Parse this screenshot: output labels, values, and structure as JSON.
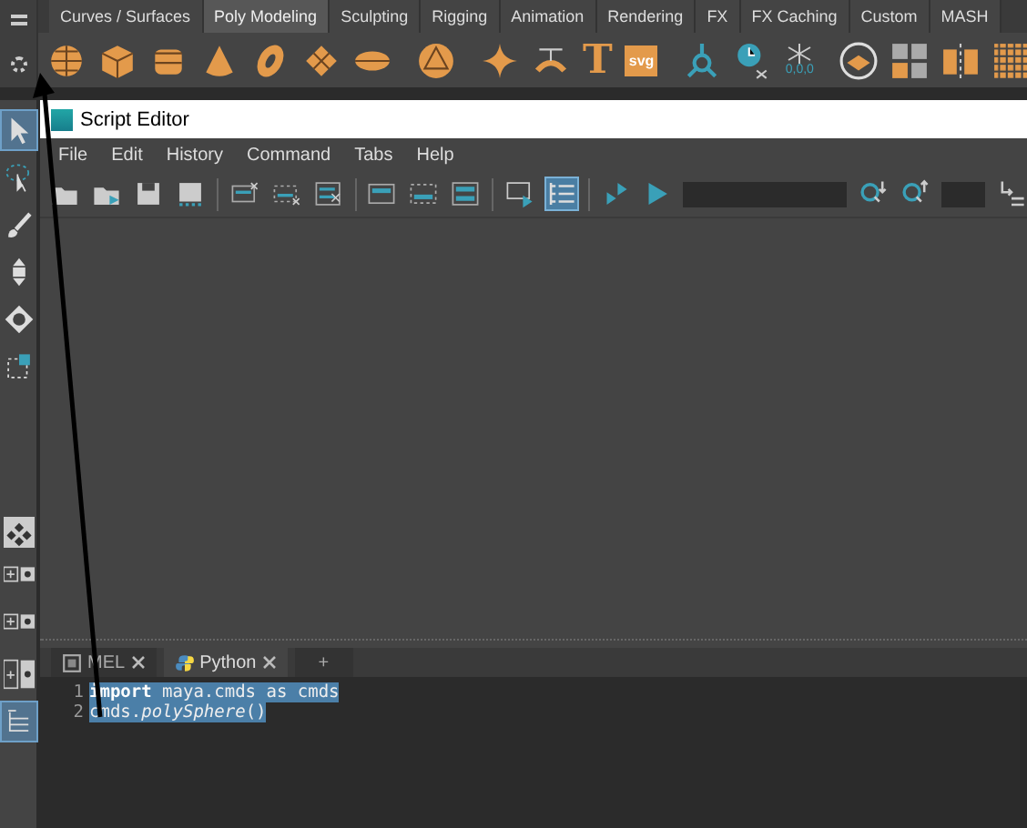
{
  "shelf": {
    "tabs": [
      {
        "label": "Curves / Surfaces",
        "selected": false
      },
      {
        "label": "Poly Modeling",
        "selected": true
      },
      {
        "label": "Sculpting",
        "selected": false
      },
      {
        "label": "Rigging",
        "selected": false
      },
      {
        "label": "Animation",
        "selected": false
      },
      {
        "label": "Rendering",
        "selected": false
      },
      {
        "label": "FX",
        "selected": false
      },
      {
        "label": "FX Caching",
        "selected": false
      },
      {
        "label": "Custom",
        "selected": false
      },
      {
        "label": "MASH",
        "selected": false
      }
    ],
    "tools": [
      {
        "kind": "sphere"
      },
      {
        "kind": "cube"
      },
      {
        "kind": "cylinder"
      },
      {
        "kind": "cone"
      },
      {
        "kind": "torus"
      },
      {
        "kind": "plane"
      },
      {
        "kind": "disc"
      },
      {
        "kind": "divider"
      },
      {
        "kind": "platonic"
      },
      {
        "kind": "divider"
      },
      {
        "kind": "sparkle"
      },
      {
        "kind": "bend"
      },
      {
        "kind": "type",
        "label": "T"
      },
      {
        "kind": "badge",
        "label": "svg"
      },
      {
        "kind": "divider"
      },
      {
        "kind": "pivot"
      },
      {
        "kind": "clock"
      },
      {
        "kind": "axis",
        "label": "0,0,0"
      },
      {
        "kind": "divider"
      },
      {
        "kind": "layers"
      },
      {
        "kind": "squares"
      },
      {
        "kind": "blocks"
      },
      {
        "kind": "dots"
      }
    ]
  },
  "toolbox": [
    {
      "kind": "select",
      "selected": true
    },
    {
      "kind": "lasso",
      "selected": false
    },
    {
      "kind": "paint",
      "selected": false
    },
    {
      "kind": "move",
      "selected": false
    },
    {
      "kind": "rotate",
      "selected": false
    },
    {
      "kind": "scale",
      "selected": false
    },
    {
      "kind": "layout",
      "selected": false
    },
    {
      "kind": "plus-pair",
      "selected": false
    },
    {
      "kind": "plus-pair",
      "selected": false
    },
    {
      "kind": "plus-tall",
      "selected": false
    },
    {
      "kind": "outliner",
      "selected": true
    }
  ],
  "script_editor": {
    "title": "Script Editor",
    "menu": [
      "File",
      "Edit",
      "History",
      "Command",
      "Tabs",
      "Help"
    ],
    "toolbar": [
      {
        "kind": "open"
      },
      {
        "kind": "open-run"
      },
      {
        "kind": "save"
      },
      {
        "kind": "save-all"
      },
      {
        "kind": "divider"
      },
      {
        "kind": "clear-history"
      },
      {
        "kind": "clear-input"
      },
      {
        "kind": "clear-all"
      },
      {
        "kind": "divider"
      },
      {
        "kind": "show-history"
      },
      {
        "kind": "show-input"
      },
      {
        "kind": "show-both"
      },
      {
        "kind": "divider"
      },
      {
        "kind": "echo"
      },
      {
        "kind": "line-numbers",
        "on": true
      },
      {
        "kind": "divider"
      },
      {
        "kind": "run-selected"
      },
      {
        "kind": "run"
      },
      {
        "kind": "search-field"
      },
      {
        "kind": "search-down"
      },
      {
        "kind": "search-up"
      },
      {
        "kind": "line-field"
      },
      {
        "kind": "goto"
      }
    ],
    "tabs": [
      {
        "label": "MEL",
        "kind": "mel",
        "selected": false
      },
      {
        "label": "Python",
        "kind": "python",
        "selected": true
      },
      {
        "label": "+",
        "kind": "add",
        "selected": false
      }
    ],
    "code": [
      {
        "number": "1",
        "text": "**import** maya.cmds as cmds",
        "selected": true
      },
      {
        "number": "2",
        "text": "cmds.*polySphere*()",
        "selected": true
      }
    ]
  }
}
